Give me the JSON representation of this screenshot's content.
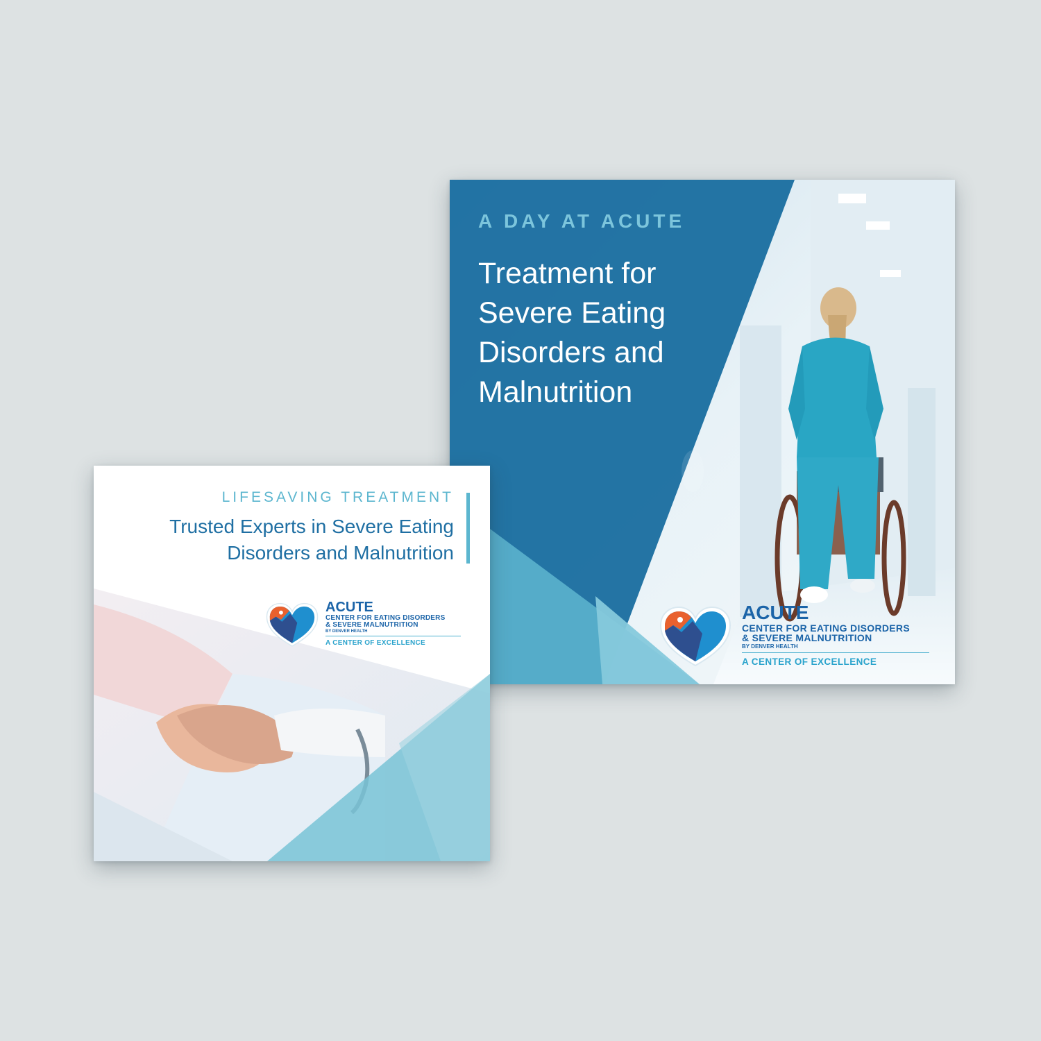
{
  "right_card": {
    "eyebrow": "A DAY AT ACUTE",
    "title": "Treatment for Severe Eating Disorders and Malnutrition"
  },
  "left_card": {
    "eyebrow": "LIFESAVING TREATMENT",
    "title": "Trusted Experts in Severe Eating Disorders and Malnutrition"
  },
  "logo": {
    "name": "ACUTE",
    "line1": "CENTER FOR EATING DISORDERS",
    "line2": "& SEVERE MALNUTRITION",
    "byline": "BY DENVER HEALTH",
    "tagline": "A CENTER OF EXCELLENCE"
  },
  "colors": {
    "background": "#dde2e3",
    "brand_blue": "#1b6ea0",
    "light_teal": "#7cc5dc",
    "title_blue": "#1f6fa3"
  },
  "images": {
    "right_photo": "nurse-pushing-wheelchair-photo",
    "left_photo": "holding-hands-hospital-photo"
  }
}
